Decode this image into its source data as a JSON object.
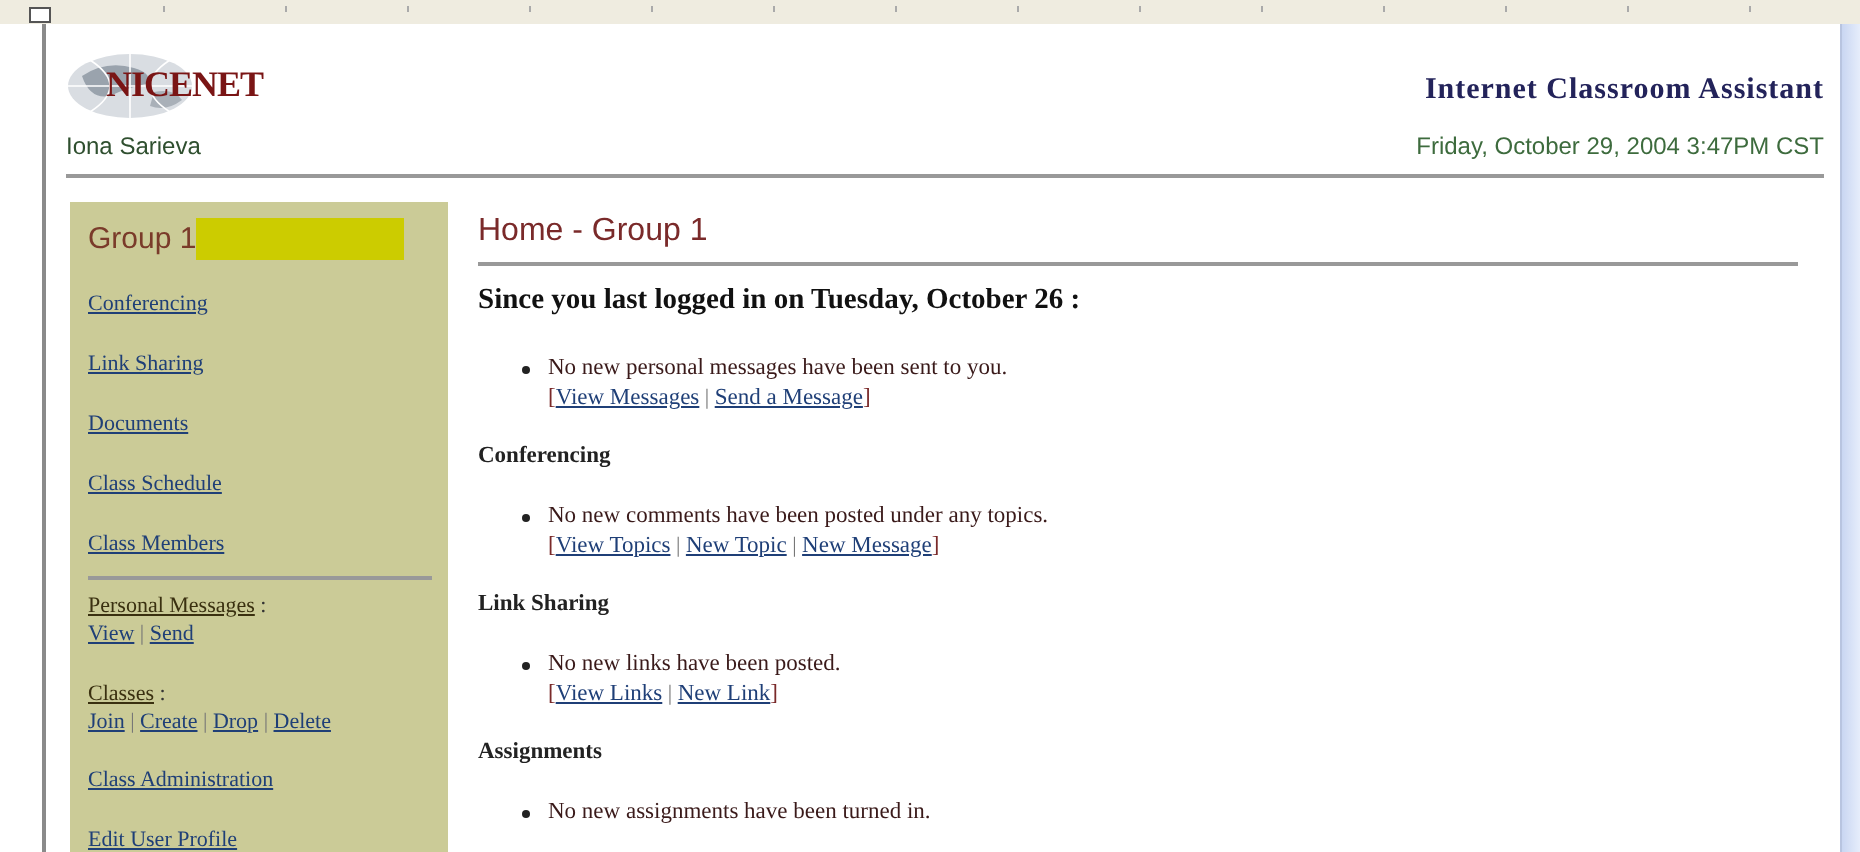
{
  "header": {
    "logo_text": "NICENET",
    "title": "Internet Classroom Assistant",
    "user_name": "Iona Sarieva",
    "datetime": "Friday, October 29, 2004 3:47PM CST"
  },
  "sidebar": {
    "group_title": "Group 1",
    "group_highlighted": true,
    "links": [
      {
        "label": "Conferencing"
      },
      {
        "label": "Link Sharing"
      },
      {
        "label": "Documents"
      },
      {
        "label": "Class Schedule"
      },
      {
        "label": "Class Members"
      }
    ],
    "sections": [
      {
        "label": "Personal Messages",
        "suffix": ":",
        "divider": "|",
        "links": [
          "View",
          "Send"
        ]
      },
      {
        "label": "Classes",
        "suffix": ":",
        "divider": "|",
        "links": [
          "Join",
          "Create",
          "Drop",
          "Delete"
        ]
      }
    ],
    "bottom_links": [
      {
        "label": "Class Administration"
      },
      {
        "label": "Edit User Profile"
      }
    ]
  },
  "main": {
    "title": "Home - Group 1",
    "since": "Since you last logged in on Tuesday, October 26 :",
    "bracket_open": "[",
    "bracket_close": "]",
    "link_divider": "|",
    "sections": [
      {
        "message": "No new personal messages have been sent to you.",
        "links": [
          "View Messages",
          "Send a Message"
        ]
      },
      {
        "heading": "Conferencing",
        "message": "No new comments have been posted under any topics.",
        "links": [
          "View Topics",
          "New Topic",
          "New Message"
        ]
      },
      {
        "heading": "Link Sharing",
        "message": "No new links have been posted.",
        "links": [
          "View Links",
          "New Link"
        ]
      },
      {
        "heading": "Assignments",
        "message": "No new assignments have been turned in."
      }
    ]
  }
}
